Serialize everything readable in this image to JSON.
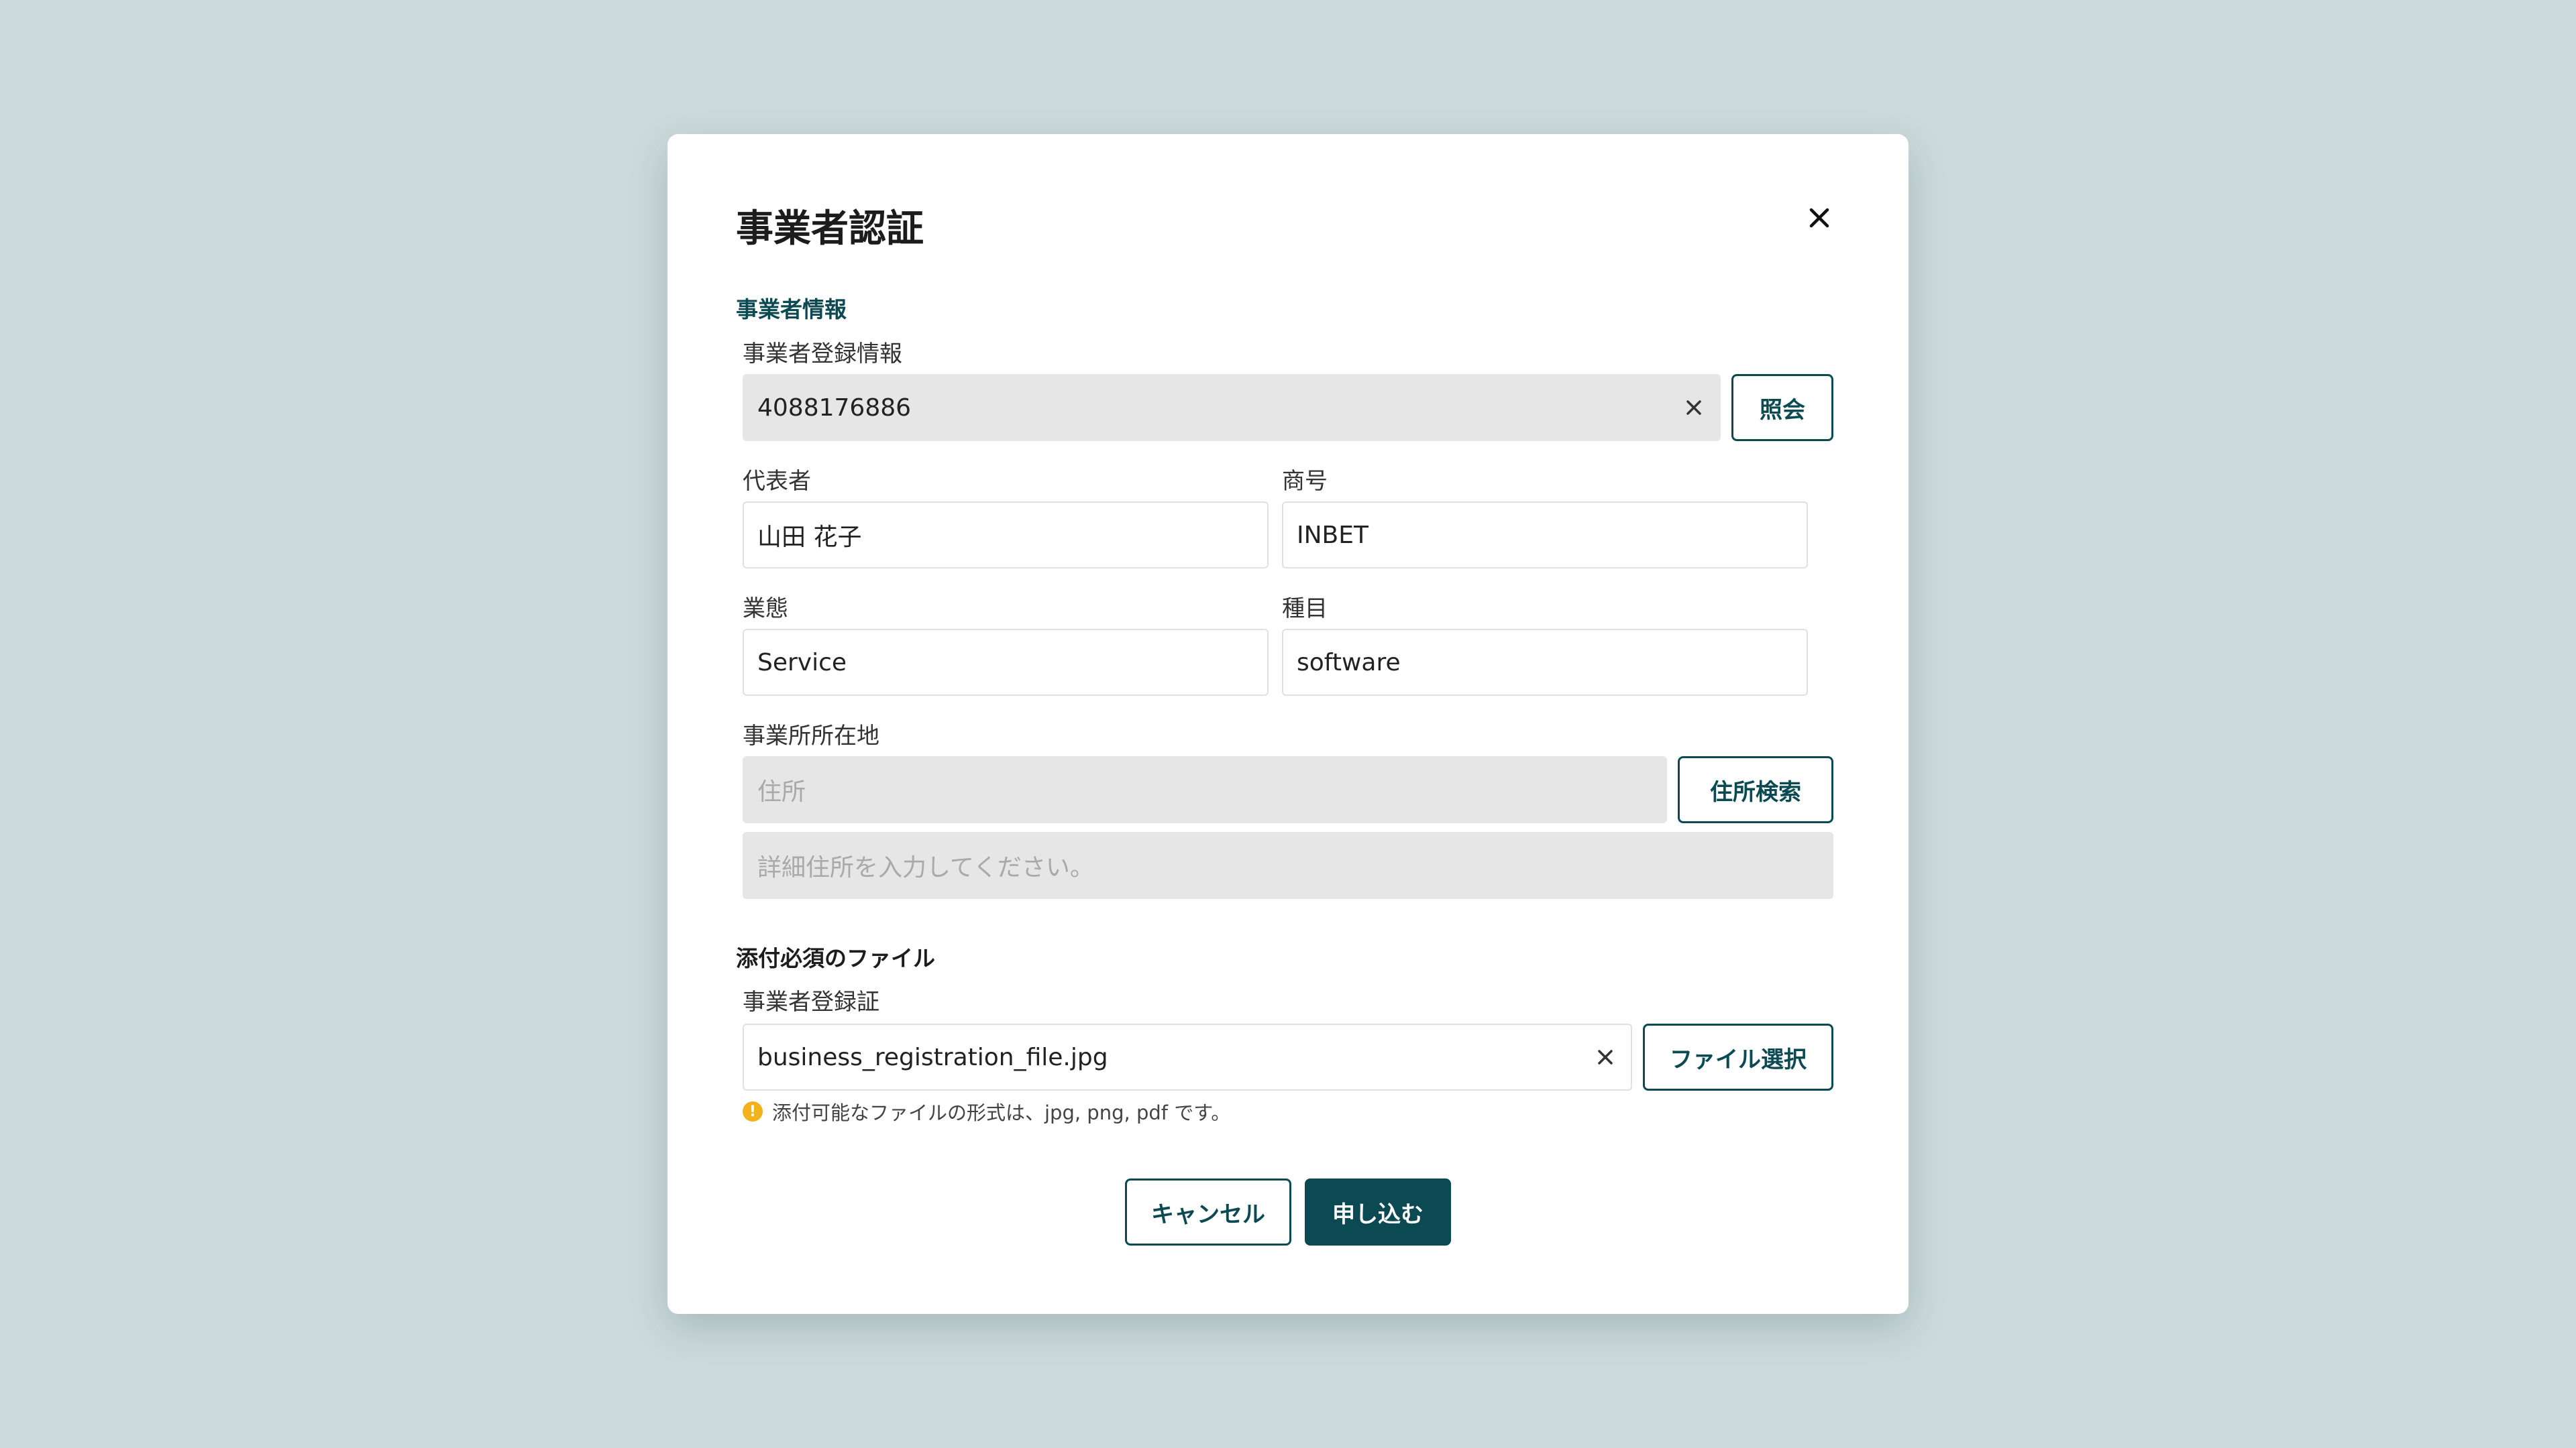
{
  "dialog": {
    "title": "事業者認証",
    "close_icon": "close-icon"
  },
  "business_info": {
    "section_title": "事業者情報",
    "registration": {
      "label": "事業者登録情報",
      "value": "4088176886",
      "lookup_button": "照会"
    },
    "representative": {
      "label": "代表者",
      "value": "山田 花子"
    },
    "trade_name": {
      "label": "商号",
      "value": "INBET"
    },
    "business_type": {
      "label": "業態",
      "value": "Service"
    },
    "business_item": {
      "label": "種目",
      "value": "software"
    },
    "address": {
      "label": "事業所所在地",
      "placeholder": "住所",
      "search_button": "住所検索",
      "detail_placeholder": "詳細住所を入力してください。"
    }
  },
  "attachments": {
    "section_title": "添付必須のファイル",
    "certificate": {
      "label": "事業者登録証",
      "value": "business_registration_file.jpg",
      "select_button": "ファイル選択"
    },
    "hint_icon": "!",
    "hint": "添付可能なファイルの形式は、jpg, png, pdf です。"
  },
  "actions": {
    "cancel": "キャンセル",
    "submit": "申し込む"
  },
  "colors": {
    "backdrop": "#ccdadb",
    "accent": "#0b4a52",
    "warning": "#f2b21b"
  }
}
